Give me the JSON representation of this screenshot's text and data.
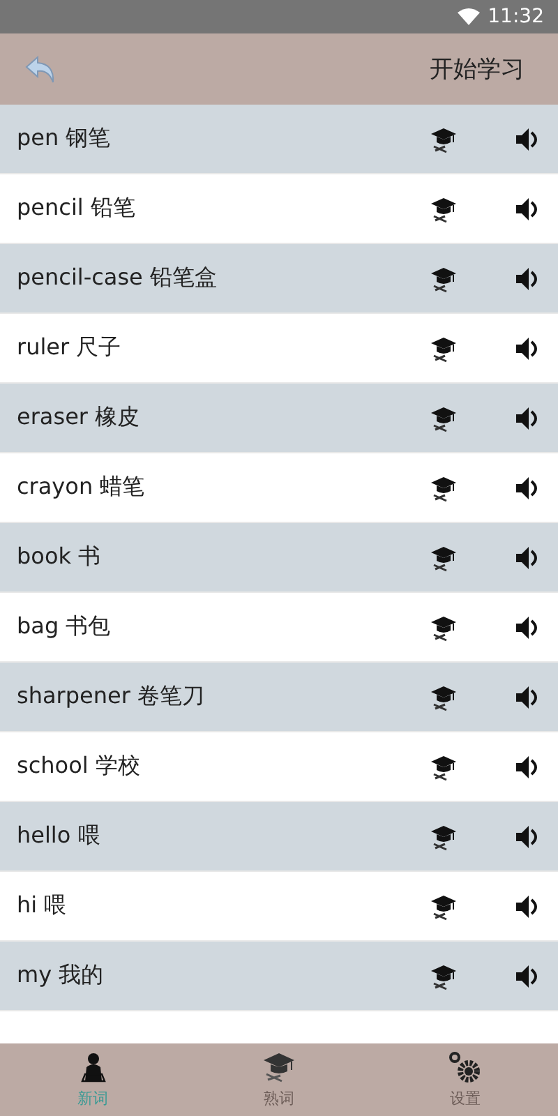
{
  "status_bar": {
    "time": "11:32"
  },
  "header": {
    "title": "开始学习"
  },
  "words": [
    {
      "text": "pen 钢笔"
    },
    {
      "text": "pencil 铅笔"
    },
    {
      "text": "pencil-case 铅笔盒"
    },
    {
      "text": "ruler 尺子"
    },
    {
      "text": "eraser 橡皮"
    },
    {
      "text": "crayon 蜡笔"
    },
    {
      "text": "book 书"
    },
    {
      "text": "bag 书包"
    },
    {
      "text": "sharpener 卷笔刀"
    },
    {
      "text": "school 学校"
    },
    {
      "text": "hello 喂"
    },
    {
      "text": "hi 喂"
    },
    {
      "text": "my 我的"
    }
  ],
  "nav": [
    {
      "label": "新词",
      "kind": "new",
      "selected": true
    },
    {
      "label": "熟词",
      "kind": "known",
      "selected": false
    },
    {
      "label": "设置",
      "kind": "settings",
      "selected": false
    }
  ]
}
